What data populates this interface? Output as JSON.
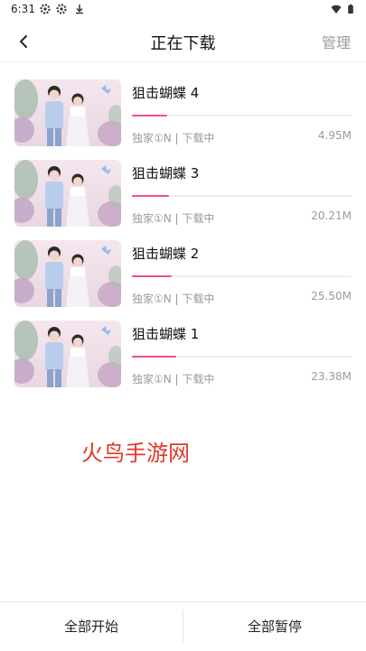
{
  "status_bar": {
    "time": "6:31",
    "left_icons": [
      "settings-gear-icon",
      "settings-gear-icon",
      "download-arrow-icon"
    ],
    "right_icons": [
      "wifi-icon",
      "battery-icon"
    ]
  },
  "header": {
    "back_icon": "back-chevron-icon",
    "title": "正在下载",
    "manage_label": "管理"
  },
  "downloads": [
    {
      "title": "狙击蝴蝶 4",
      "tag": "独家①N | 下载中",
      "size": "4.95M",
      "progress": 0.16
    },
    {
      "title": "狙击蝴蝶 3",
      "tag": "独家①N | 下载中",
      "size": "20.21M",
      "progress": 0.17
    },
    {
      "title": "狙击蝴蝶 2",
      "tag": "独家①N | 下载中",
      "size": "25.50M",
      "progress": 0.18
    },
    {
      "title": "狙击蝴蝶 1",
      "tag": "独家①N | 下载中",
      "size": "23.38M",
      "progress": 0.2
    }
  ],
  "watermark": "火鸟手游网",
  "footer": {
    "start_all_label": "全部开始",
    "pause_all_label": "全部暂停"
  },
  "colors": {
    "progress_fill": "#f24b8f",
    "progress_track": "#ededed",
    "watermark": "#e03a2c",
    "muted_text": "#9a9a9a"
  }
}
